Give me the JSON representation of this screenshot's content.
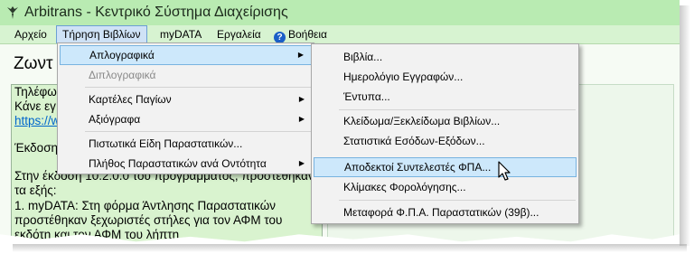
{
  "window": {
    "title": "Arbitrans - Κεντρικό Σύστημα Διαχείρισης",
    "accent_color": "#b9ebb2",
    "menubar_color": "#d7f3d1"
  },
  "menubar": {
    "items": [
      "Αρχείο",
      "Τήρηση Βιβλίων",
      "myDATA",
      "Εργαλεία",
      "Βοήθεια"
    ],
    "active": "Τήρηση Βιβλίων",
    "help_icon": "help-icon"
  },
  "content": {
    "heading": "Ζωντ",
    "text_lines": [
      "Τηλέφω",
      "Κάνε εγ",
      "https://w",
      "",
      "Έκδοση",
      "",
      "Στην έκδοση 10.2.0.0 του προγράμματος, προστέθηκαν",
      "τα εξής:",
      "1. myDATA: Στη φόρμα Άντλησης Παραστατικών",
      "προστέθηκαν ξεχωριστές στήλες για τον ΑΦΜ του",
      "εκδότη και τον ΑΦΜ του λήπτη"
    ]
  },
  "dropdown": {
    "items": [
      {
        "label": "Απλογραφικά",
        "has_submenu": true,
        "state": "highlighted"
      },
      {
        "label": "Διπλογραφικά",
        "has_submenu": false,
        "state": "disabled"
      },
      {
        "label": "Καρτέλες Παγίων",
        "has_submenu": true,
        "state": "normal"
      },
      {
        "label": "Αξιόγραφα",
        "has_submenu": true,
        "state": "normal"
      },
      {
        "label": "Πιστωτικά Είδη Παραστατικών...",
        "has_submenu": false,
        "state": "normal"
      },
      {
        "label": "Πλήθος Παραστατικών ανά Οντότητα",
        "has_submenu": true,
        "state": "normal"
      }
    ]
  },
  "submenu": {
    "items": [
      {
        "label": "Βιβλία...",
        "state": "normal"
      },
      {
        "label": "Ημερολόγιο Εγγραφών...",
        "state": "normal"
      },
      {
        "label": "Έντυπα...",
        "state": "normal"
      },
      {
        "label": "Κλείδωμα/Ξεκλείδωμα Βιβλίων...",
        "state": "normal"
      },
      {
        "label": "Στατιστικά Εσόδων-Εξόδων...",
        "state": "normal"
      },
      {
        "label": "Αποδεκτοί Συντελεστές ΦΠΑ...",
        "state": "highlighted"
      },
      {
        "label": "Κλίμακες Φορολόγησης...",
        "state": "normal"
      },
      {
        "label": "Μεταφορά Φ.Π.Α. Παραστατικών (39β)...",
        "state": "normal"
      }
    ]
  },
  "highlight_color": "#cde8fb"
}
